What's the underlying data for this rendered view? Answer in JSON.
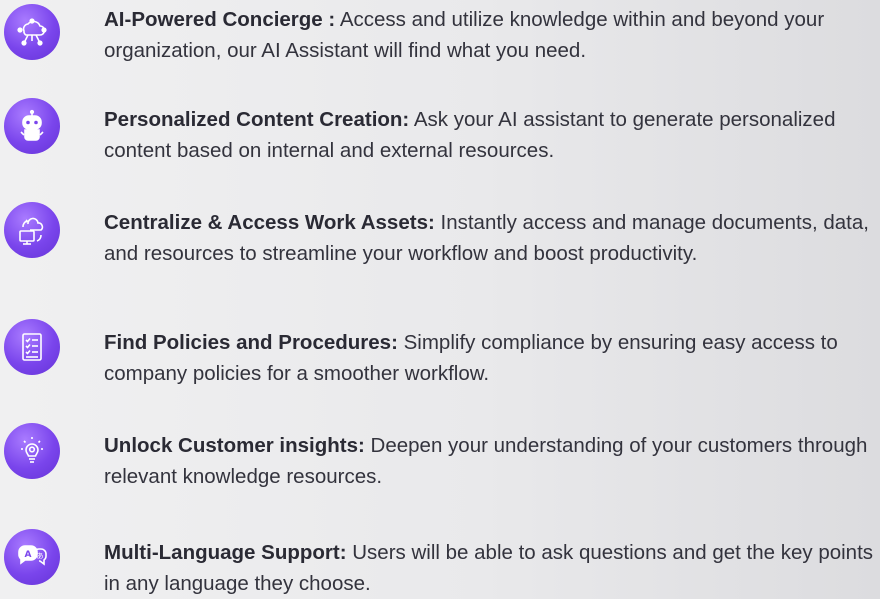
{
  "features": [
    {
      "icon": "network-cloud-icon",
      "title": "AI-Powered Concierge :",
      "description": "Access and utilize knowledge within and beyond your organization, our AI Assistant will find what you need."
    },
    {
      "icon": "robot-icon",
      "title": "Personalized Content Creation:",
      "description": "Ask your AI assistant to generate personalized content based on internal and external resources."
    },
    {
      "icon": "cloud-monitor-sync-icon",
      "title": "Centralize & Access Work Assets:",
      "description": "Instantly access and manage documents, data, and resources to streamline your workflow and boost productivity."
    },
    {
      "icon": "checklist-document-icon",
      "title": "Find Policies and Procedures:",
      "description": "Simplify compliance by ensuring easy access to company policies for a smoother workflow."
    },
    {
      "icon": "lightbulb-gear-icon",
      "title": "Unlock Customer insights:",
      "description": "Deepen your understanding of your customers through relevant knowledge resources."
    },
    {
      "icon": "translate-chat-icon",
      "title": "Multi-Language Support:",
      "description": "Users will be able to ask questions and get the key points in any language they choose."
    }
  ],
  "colors": {
    "icon_purple": "#7a45ec",
    "text": "#33333d",
    "background": "#ebebed"
  }
}
